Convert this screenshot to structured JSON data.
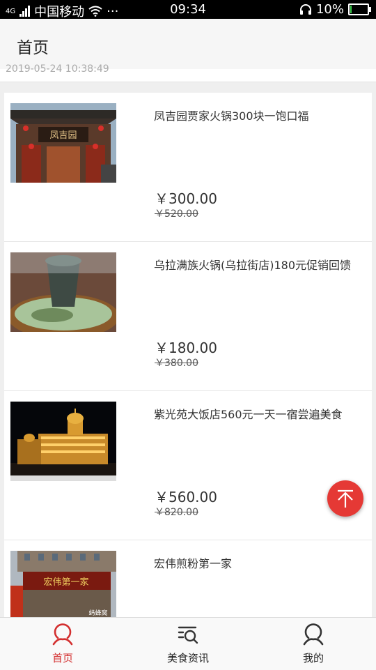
{
  "status_bar": {
    "network": "4G",
    "carrier": "中国移动",
    "more": "···",
    "time": "09:34",
    "battery": "10%",
    "battery_level": 0.1
  },
  "header": {
    "title": "首页"
  },
  "list_top_peek": "2019-05-24 10:38:49",
  "items": [
    {
      "title": "凤吉园贾家火锅300块一饱口福",
      "price": "￥300.00",
      "original_price": "￥520.00"
    },
    {
      "title": "乌拉满族火锅(乌拉街店)180元促销回馈",
      "price": "￥180.00",
      "original_price": "￥380.00"
    },
    {
      "title": "紫光苑大饭店560元一天一宿尝遍美食",
      "price": "￥560.00",
      "original_price": "￥820.00"
    },
    {
      "title": "宏伟煎粉第一家",
      "price": "",
      "original_price": ""
    }
  ],
  "image_text": {
    "sign_1": "凤吉园",
    "sign_4": "宏伟第一家",
    "watermark_4": "蚂蜂窝"
  },
  "tabbar": {
    "tabs": [
      {
        "label": "首页",
        "icon": "home-icon",
        "active": true
      },
      {
        "label": "美食资讯",
        "icon": "food-news-icon",
        "active": false
      },
      {
        "label": "我的",
        "icon": "profile-icon",
        "active": false
      }
    ]
  },
  "colors": {
    "accent": "#d32f2f",
    "fab": "#e53935",
    "status_bar": "#000000"
  }
}
